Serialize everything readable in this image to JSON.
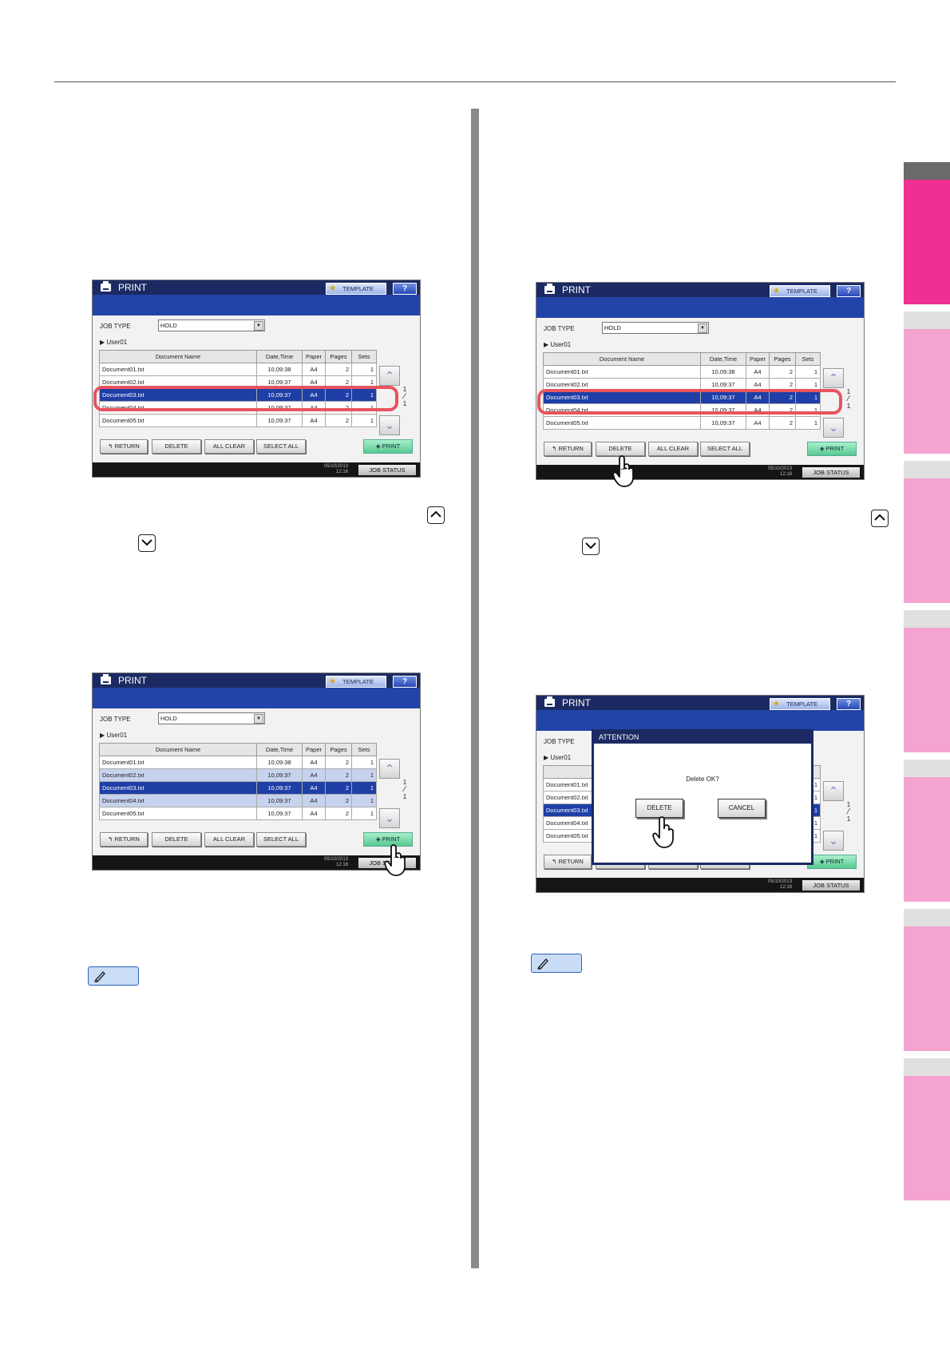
{
  "screens": [
    {
      "title": "PRINT",
      "template_label": "TEMPLATE",
      "help_label": "?",
      "job_type_label": "JOB TYPE",
      "job_type_value": "HOLD",
      "user": "User01",
      "columns": [
        "Document Name",
        "Date,Time",
        "Paper",
        "Pages",
        "Sets"
      ],
      "rows": [
        [
          "Document01.txt",
          "10,09:38",
          "A4",
          "2",
          "1"
        ],
        [
          "Document02.txt",
          "10,09:37",
          "A4",
          "2",
          "1"
        ],
        [
          "Document03.txt",
          "10,09:37",
          "A4",
          "2",
          "1"
        ],
        [
          "Document04.txt",
          "10,09:37",
          "A4",
          "2",
          "1"
        ],
        [
          "Document05.txt",
          "10,09:37",
          "A4",
          "2",
          "1"
        ]
      ],
      "page_current": "1",
      "page_total": "1",
      "buttons": {
        "return": "RETURN",
        "delete": "DELETE",
        "all_clear": "ALL CLEAR",
        "select_all": "SELECT ALL",
        "print": "PRINT"
      },
      "clock_date": "05/10/2013",
      "clock_time": "12:16",
      "job_status": "JOB STATUS"
    }
  ],
  "dialog": {
    "title": "ATTENTION",
    "message": "Delete OK?",
    "delete": "DELETE",
    "cancel": "CANCEL"
  },
  "colors": {
    "accent_tab": "#ef2f94",
    "inactive_tab": "#f5a3cf",
    "highlight_ring": "#e8545e",
    "screen_titlebar": "#1c2a63",
    "selected_row": "#1f3fa6"
  }
}
